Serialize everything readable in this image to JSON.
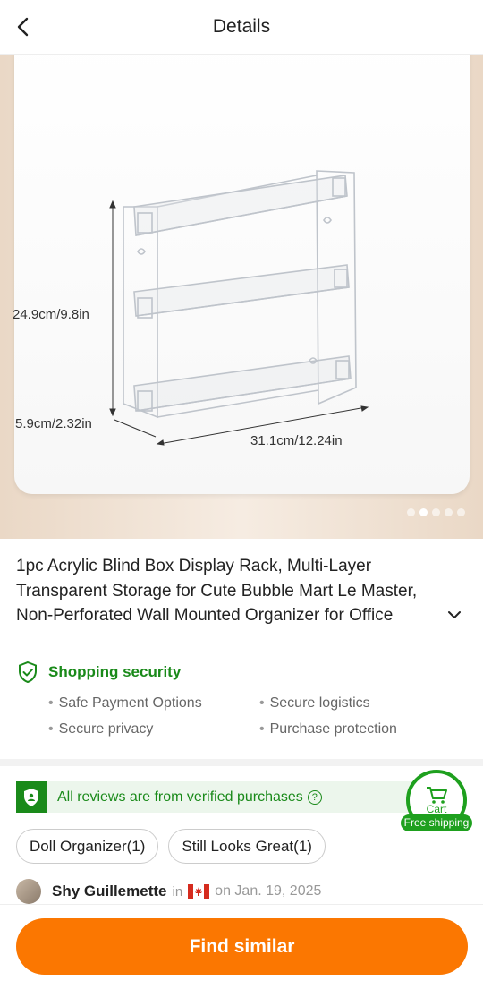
{
  "header": {
    "title": "Details",
    "back_icon": "chevron-left-icon"
  },
  "gallery": {
    "dimensions": {
      "height": "24.9cm/9.8in",
      "depth": "5.9cm/2.32in",
      "width": "31.1cm/12.24in"
    },
    "image_count": 5,
    "active_index": 1
  },
  "product": {
    "title": "1pc Acrylic Blind Box Display Rack, Multi-Layer Transparent Storage for Cute Bubble Mart Le Master, Non-Perforated Wall Mounted Organizer for Office"
  },
  "security": {
    "title": "Shopping security",
    "items": [
      "Safe Payment Options",
      "Secure logistics",
      "Secure privacy",
      "Purchase protection"
    ]
  },
  "reviews": {
    "verified_text": "All reviews are from verified purchases",
    "tags": [
      "Doll Organizer(1)",
      "Still Looks Great(1)"
    ],
    "first_review": {
      "name": "Shy Guillemette",
      "in": "in",
      "date": "on Jan. 19, 2025"
    }
  },
  "cart": {
    "label": "Cart",
    "badge": "Free shipping"
  },
  "actions": {
    "find_similar": "Find similar"
  },
  "colors": {
    "accent": "#fb7701",
    "green": "#1a8a1a"
  }
}
